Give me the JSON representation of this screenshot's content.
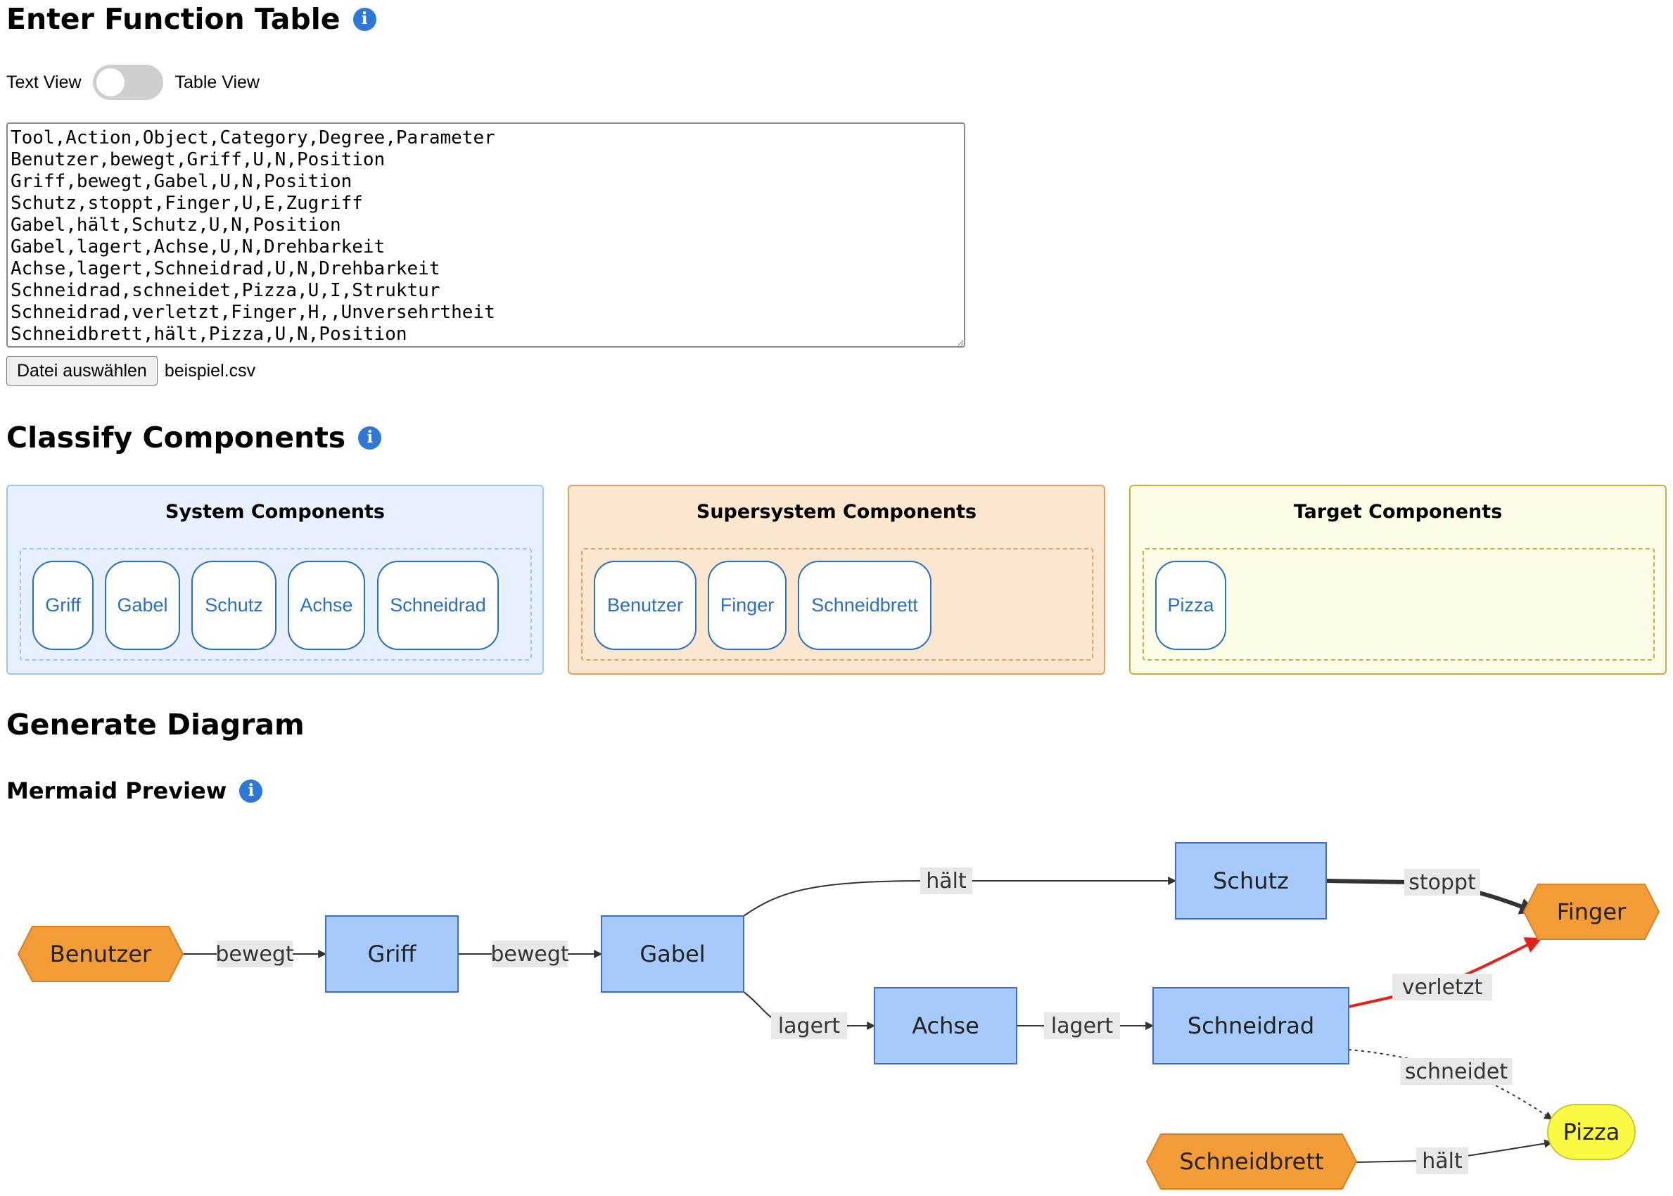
{
  "sections": {
    "function_table": "Enter Function Table",
    "classify": "Classify Components",
    "generate": "Generate Diagram",
    "preview": "Mermaid Preview",
    "info_glyph": "i"
  },
  "toggle": {
    "left_label": "Text View",
    "right_label": "Table View",
    "state": "Text View"
  },
  "textarea": {
    "lines": [
      "Tool,Action,Object,Category,Degree,Parameter",
      "Benutzer,bewegt,Griff,U,N,Position",
      "Griff,bewegt,Gabel,U,N,Position",
      "Schutz,stoppt,Finger,U,E,Zugriff",
      "Gabel,hält,Schutz,U,N,Position",
      "Gabel,lagert,Achse,U,N,Drehbarkeit",
      "Achse,lagert,Schneidrad,U,N,Drehbarkeit",
      "Schneidrad,schneidet,Pizza,U,I,Struktur",
      "Schneidrad,verletzt,Finger,H,,Unversehrtheit",
      "Schneidbrett,hält,Pizza,U,N,Position"
    ]
  },
  "file": {
    "button_label": "Datei auswählen",
    "file_name": "beispiel.csv"
  },
  "panels": {
    "system": {
      "title": "System Components",
      "items": [
        "Griff",
        "Gabel",
        "Schutz",
        "Achse",
        "Schneidrad"
      ]
    },
    "supersystem": {
      "title": "Supersystem Components",
      "items": [
        "Benutzer",
        "Finger",
        "Schneidbrett"
      ]
    },
    "target": {
      "title": "Target Components",
      "items": [
        "Pizza"
      ]
    }
  },
  "colors": {
    "accent": "#2f78d6",
    "chip": "#2c6fc0",
    "system_bg": "#e6f1fd",
    "system_border": "#9cc8ee",
    "supersystem_bg": "#fbe6d0",
    "supersystem_border": "#e8a15a",
    "target_bg": "#fefee8",
    "target_border": "#c9ad3e",
    "node_system": "#a6caf9",
    "node_supersystem": "#f29b37",
    "node_target": "#fafa45",
    "edge_harmful": "#e0231d",
    "edge_default": "#333333",
    "edge_label_bg": "#e8e8e8"
  },
  "diagram": {
    "nodes": [
      {
        "id": "Benutzer",
        "label": "Benutzer",
        "kind": "supersystem"
      },
      {
        "id": "Griff",
        "label": "Griff",
        "kind": "system"
      },
      {
        "id": "Gabel",
        "label": "Gabel",
        "kind": "system"
      },
      {
        "id": "Schutz",
        "label": "Schutz",
        "kind": "system"
      },
      {
        "id": "Achse",
        "label": "Achse",
        "kind": "system"
      },
      {
        "id": "Schneidrad",
        "label": "Schneidrad",
        "kind": "system"
      },
      {
        "id": "Finger",
        "label": "Finger",
        "kind": "supersystem"
      },
      {
        "id": "Pizza",
        "label": "Pizza",
        "kind": "target"
      },
      {
        "id": "Schneidbrett",
        "label": "Schneidbrett",
        "kind": "supersystem"
      }
    ],
    "edges": [
      {
        "from": "Benutzer",
        "to": "Griff",
        "label": "bewegt",
        "style": "normal"
      },
      {
        "from": "Griff",
        "to": "Gabel",
        "label": "bewegt",
        "style": "normal"
      },
      {
        "from": "Gabel",
        "to": "Schutz",
        "label": "hält",
        "style": "normal"
      },
      {
        "from": "Gabel",
        "to": "Achse",
        "label": "lagert",
        "style": "normal"
      },
      {
        "from": "Achse",
        "to": "Schneidrad",
        "label": "lagert",
        "style": "normal"
      },
      {
        "from": "Schutz",
        "to": "Finger",
        "label": "stoppt",
        "style": "excessive"
      },
      {
        "from": "Schneidrad",
        "to": "Finger",
        "label": "verletzt",
        "style": "harmful"
      },
      {
        "from": "Schneidrad",
        "to": "Pizza",
        "label": "schneidet",
        "style": "insufficient"
      },
      {
        "from": "Schneidbrett",
        "to": "Pizza",
        "label": "hält",
        "style": "normal"
      }
    ]
  }
}
